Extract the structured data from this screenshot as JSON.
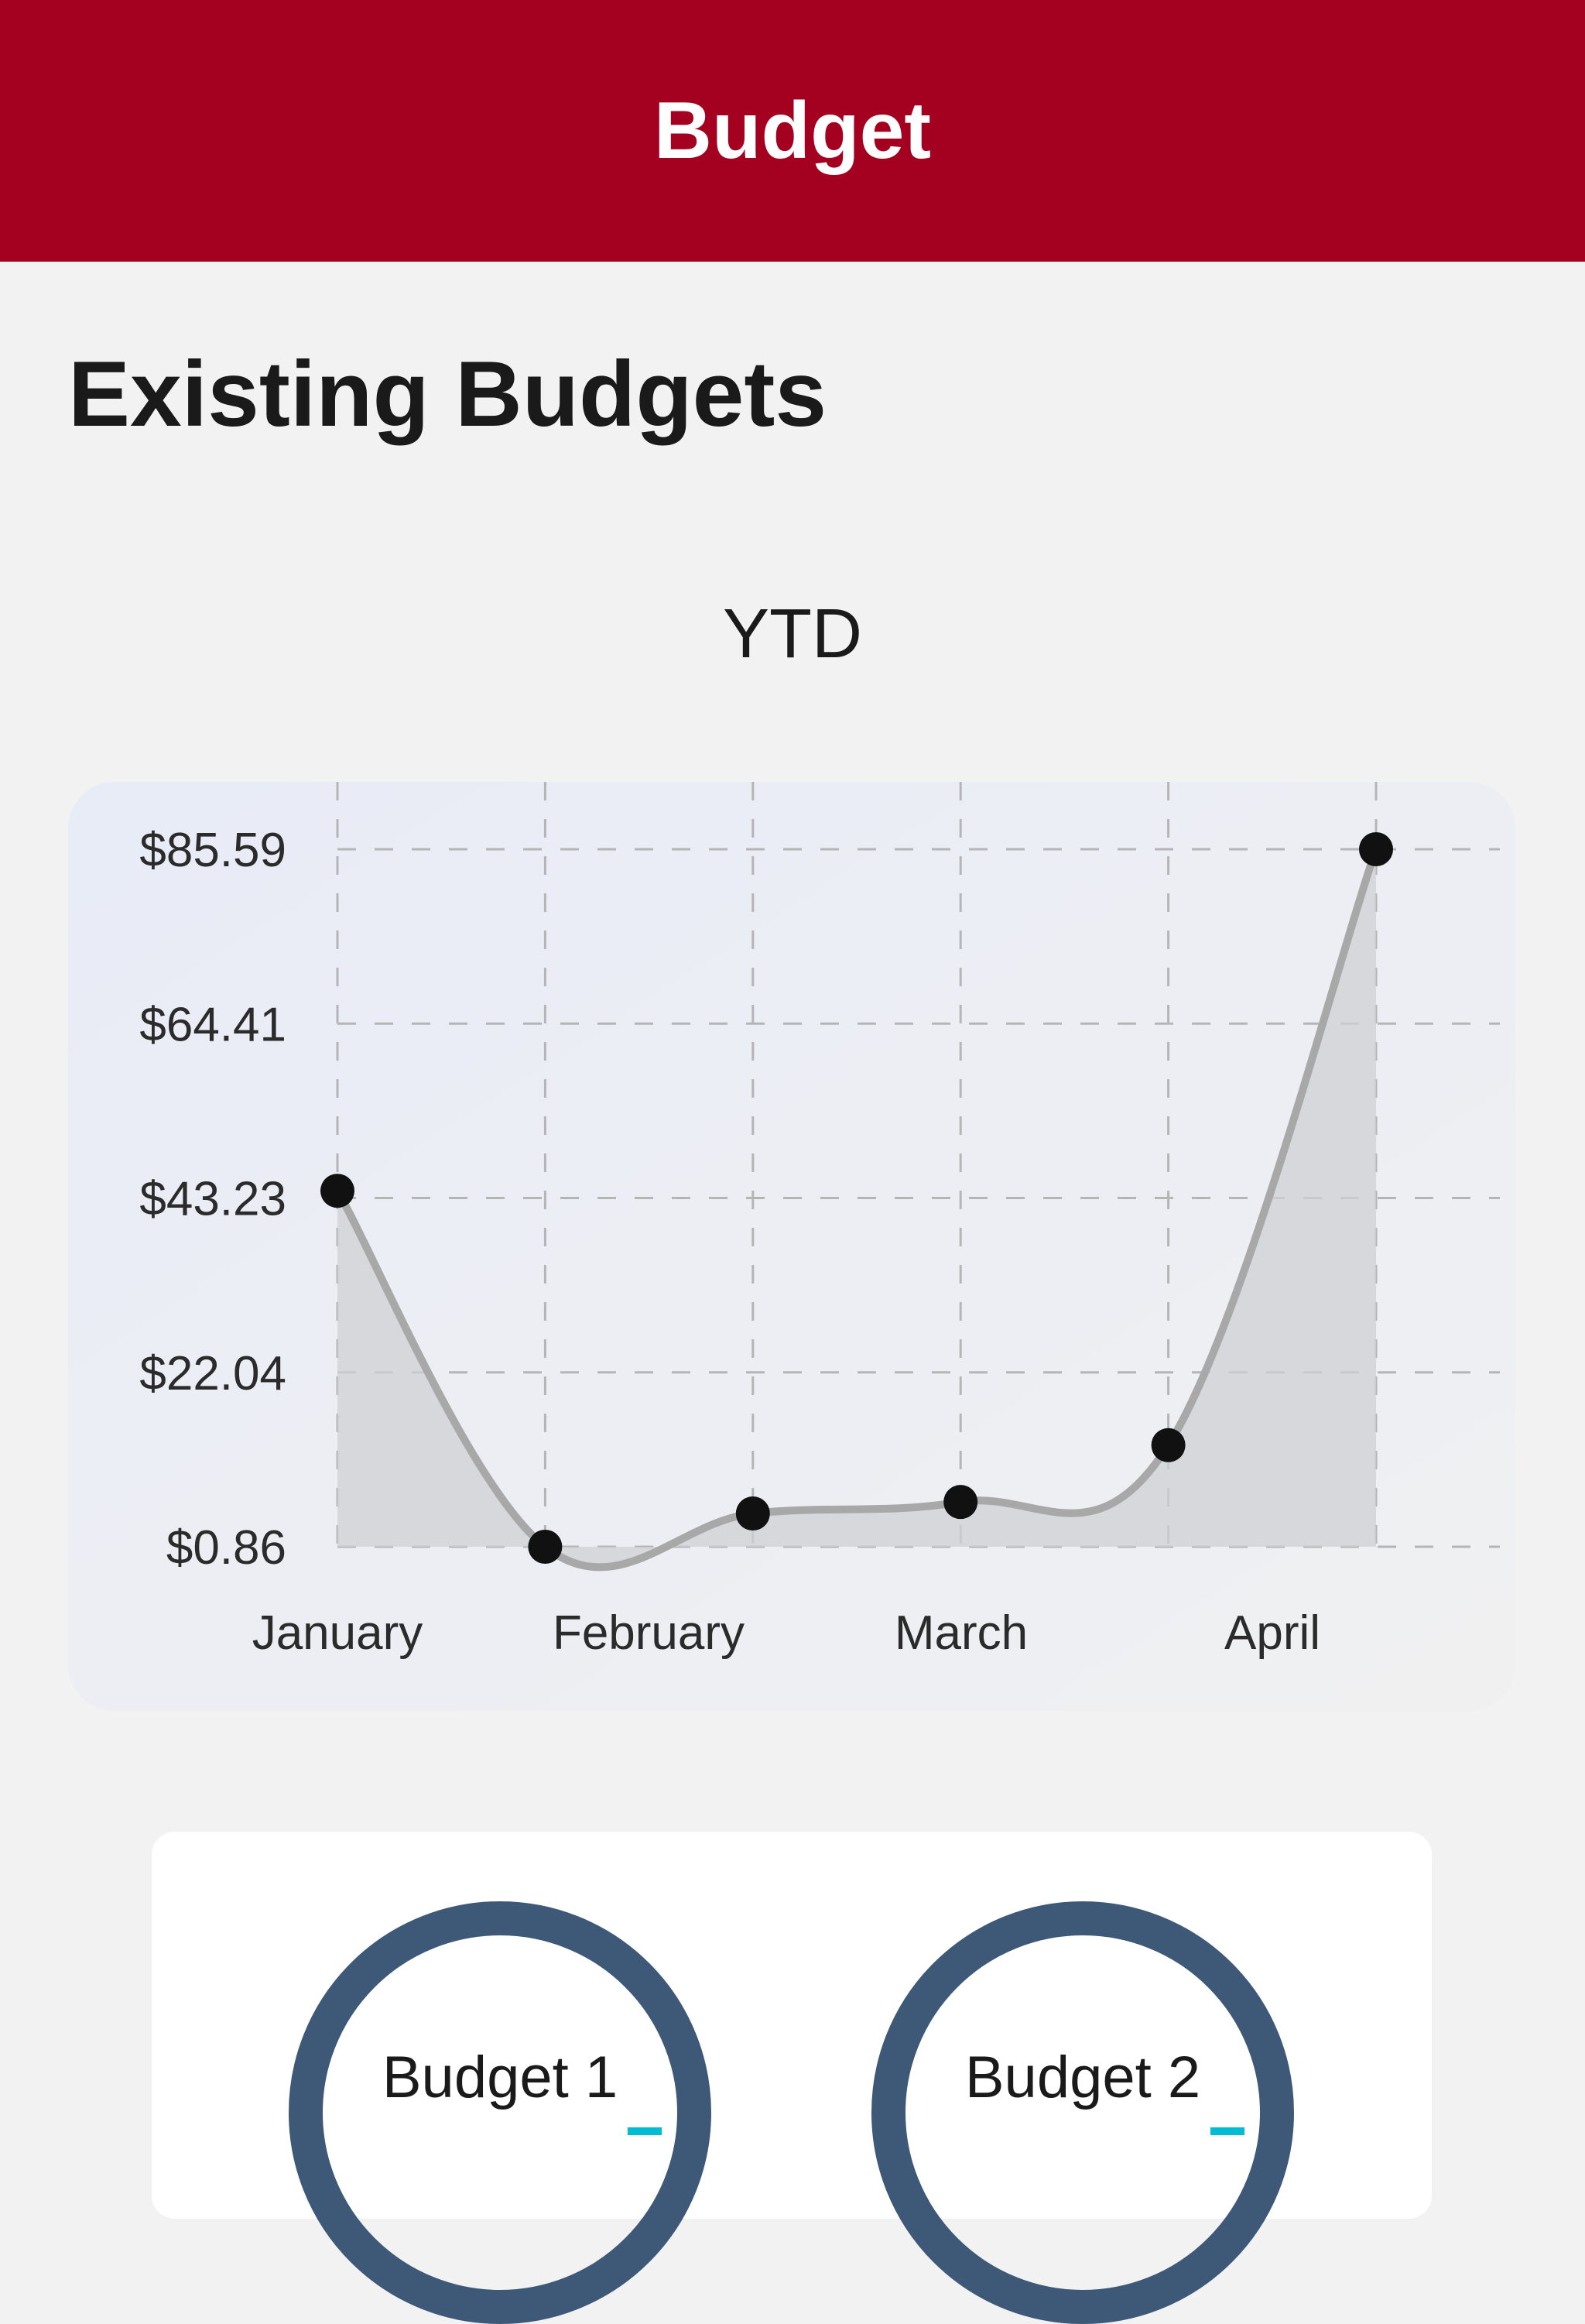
{
  "header": {
    "title": "Budget"
  },
  "section": {
    "title": "Existing Budgets"
  },
  "colors": {
    "header_bg": "#a4001f",
    "ring": "#3d5977",
    "ring_accent": "#00bcd4"
  },
  "chart_data": {
    "type": "line",
    "title": "YTD",
    "xlabel": "",
    "ylabel": "",
    "x_tick_labels": [
      "January",
      "February",
      "March",
      "April"
    ],
    "y_tick_labels": [
      "$85.59",
      "$64.41",
      "$43.23",
      "$22.04",
      "$0.86"
    ],
    "ylim": [
      0.86,
      85.59
    ],
    "points": [
      44.1,
      0.86,
      4.9,
      6.3,
      13.2,
      85.59
    ],
    "grid": true,
    "legend": "none"
  },
  "budgets": [
    {
      "label": "Budget 1"
    },
    {
      "label": "Budget 2"
    }
  ]
}
